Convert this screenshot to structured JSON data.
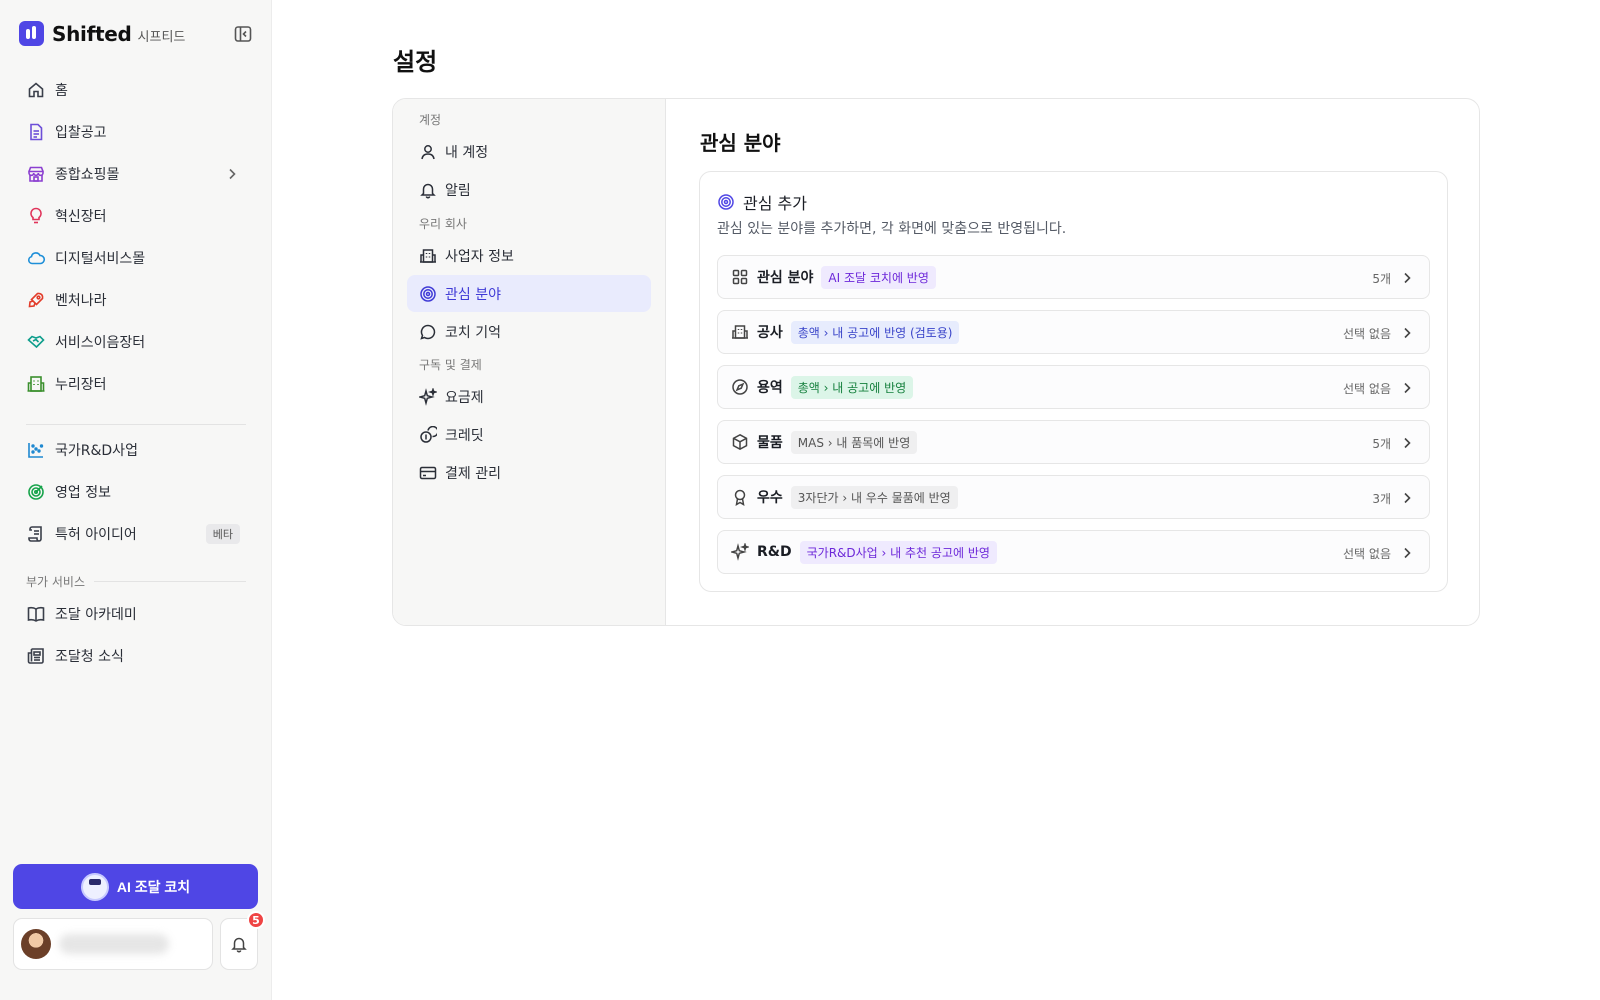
{
  "brand": {
    "name": "Shifted",
    "sub": "시프티드"
  },
  "sidebar": {
    "items": [
      {
        "label": "홈",
        "icon": "home-icon"
      },
      {
        "label": "입찰공고",
        "icon": "document-icon"
      },
      {
        "label": "종합쇼핑몰",
        "icon": "store-icon"
      },
      {
        "label": "혁신장터",
        "icon": "lightbulb-icon"
      },
      {
        "label": "디지털서비스몰",
        "icon": "cloud-icon"
      },
      {
        "label": "벤처나라",
        "icon": "rocket-icon"
      },
      {
        "label": "서비스이음장터",
        "icon": "handshake-icon"
      },
      {
        "label": "누리장터",
        "icon": "building-icon"
      },
      {
        "label": "국가R&D사업",
        "icon": "chart-icon"
      },
      {
        "label": "영업 정보",
        "icon": "target-icon"
      },
      {
        "label": "특허 아이디어",
        "icon": "scroll-icon",
        "badge": "베타"
      },
      {
        "label": "조달 아카데미",
        "icon": "book-icon"
      },
      {
        "label": "조달청 소식",
        "icon": "newspaper-icon"
      }
    ],
    "section_label": "부가 서비스",
    "coach_button": "AI 조달 코치",
    "notification_count": "5"
  },
  "page": {
    "title": "설정"
  },
  "settings_nav": {
    "groups": [
      {
        "label": "계정",
        "items": [
          {
            "label": "내 계정",
            "icon": "user-icon"
          },
          {
            "label": "알림",
            "icon": "bell-icon"
          }
        ]
      },
      {
        "label": "우리 회사",
        "items": [
          {
            "label": "사업자 정보",
            "icon": "building-icon"
          },
          {
            "label": "관심 분야",
            "icon": "target-icon",
            "active": true
          },
          {
            "label": "코치 기억",
            "icon": "chat-icon"
          }
        ]
      },
      {
        "label": "구독 및 결제",
        "items": [
          {
            "label": "요금제",
            "icon": "sparkles-icon"
          },
          {
            "label": "크레딧",
            "icon": "coins-icon"
          },
          {
            "label": "결제 관리",
            "icon": "credit-card-icon"
          }
        ]
      }
    ]
  },
  "content": {
    "title": "관심 분야",
    "card_title": "관심 추가",
    "card_desc": "관심 있는 분야를 추가하면, 각 화면에 맞춤으로 반영됩니다.",
    "rows": [
      {
        "label": "관심 분야",
        "tag": "AI 조달 코치에 반영",
        "tag_color": "#6d28d9",
        "value": "5개",
        "icon": "grid-icon"
      },
      {
        "label": "공사",
        "tag": "총액 › 내 공고에 반영 (검토용)",
        "tag_color": "#3a45c9",
        "value": "선택 없음",
        "icon": "building-icon"
      },
      {
        "label": "용역",
        "tag": "총액 › 내 공고에 반영",
        "tag_color": "#15803d",
        "value": "선택 없음",
        "icon": "compass-icon"
      },
      {
        "label": "물품",
        "tag": "MAS › 내 품목에 반영",
        "tag_color": "#555555",
        "value": "5개",
        "icon": "box-icon"
      },
      {
        "label": "우수",
        "tag": "3자단가 › 내 우수 물품에 반영",
        "tag_color": "#555555",
        "value": "3개",
        "icon": "award-icon"
      },
      {
        "label": "R&D",
        "tag": "국가R&D사업 › 내 추천 공고에 반영",
        "tag_color": "#6d28d9",
        "value": "선택 없음",
        "icon": "sparkles-icon"
      }
    ]
  }
}
